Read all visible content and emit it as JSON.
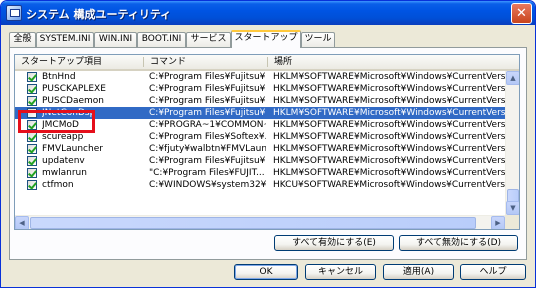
{
  "window": {
    "title": "システム 構成ユーティリティ",
    "close_label": "✕"
  },
  "tabs": [
    {
      "label": "全般"
    },
    {
      "label": "SYSTEM.INI"
    },
    {
      "label": "WIN.INI"
    },
    {
      "label": "BOOT.INI"
    },
    {
      "label": "サービス"
    },
    {
      "label": "スタートアップ"
    },
    {
      "label": "ツール"
    }
  ],
  "active_tab": "スタートアップ",
  "list": {
    "columns": [
      "スタートアップ項目",
      "コマンド",
      "場所"
    ],
    "rows": [
      {
        "name": "BtnHnd",
        "command": "C:¥Program Files¥Fujitsu¥...",
        "location": "HKLM¥SOFTWARE¥Microsoft¥Windows¥CurrentVersion¥Run",
        "checked": true
      },
      {
        "name": "PUSCKAPLEXE",
        "command": "C:¥Program Files¥Fujitsu¥...",
        "location": "HKLM¥SOFTWARE¥Microsoft¥Windows¥CurrentVersion¥Run",
        "checked": true
      },
      {
        "name": "PUSCDaemon",
        "command": "C:¥Program Files¥Fujitsu¥...",
        "location": "HKLM¥SOFTWARE¥Microsoft¥Windows¥CurrentVersion¥Run",
        "checked": true
      },
      {
        "name": "JNetConDsp",
        "command": "C:¥Program Files¥Fujitsu¥...",
        "location": "HKLM¥SOFTWARE¥Microsoft¥Windows¥CurrentVersion¥Run",
        "checked": false,
        "selected": true
      },
      {
        "name": "JMCMoD",
        "command": "C:¥PROGRA~1¥COMMON~...",
        "location": "HKLM¥SOFTWARE¥Microsoft¥Windows¥CurrentVersion¥Run",
        "checked": true
      },
      {
        "name": "scureapp",
        "command": "C:¥Program Files¥Softex¥...",
        "location": "HKLM¥SOFTWARE¥Microsoft¥Windows¥CurrentVersion¥Run",
        "checked": true
      },
      {
        "name": "FMVLauncher",
        "command": "C:¥fjuty¥walbtn¥FMVLaun...",
        "location": "HKLM¥SOFTWARE¥Microsoft¥Windows¥CurrentVersion¥Run",
        "checked": true
      },
      {
        "name": "updatenv",
        "command": "C:¥Program Files¥Fujitsu¥...",
        "location": "HKLM¥SOFTWARE¥Microsoft¥Windows¥CurrentVersion¥Run",
        "checked": true
      },
      {
        "name": "mwlanrun",
        "command": "\"C:¥Program Files¥FUJIT...",
        "location": "HKLM¥SOFTWARE¥Microsoft¥Windows¥CurrentVersion¥Run",
        "checked": true
      },
      {
        "name": "ctfmon",
        "command": "C:¥WINDOWS¥system32¥c...",
        "location": "HKCU¥SOFTWARE¥Microsoft¥Windows¥CurrentVersion¥Run",
        "checked": true
      }
    ]
  },
  "buttons": {
    "enable_all": "すべて有効にする(E)",
    "disable_all": "すべて無効にする(D)",
    "ok": "OK",
    "cancel": "キャンセル",
    "apply": "適用(A)",
    "help": "ヘルプ"
  },
  "scroll": {
    "up": "▲",
    "down": "▼",
    "left": "◀",
    "right": "▶"
  },
  "colors": {
    "selection": "#316ac5",
    "highlight_box": "#e50f1b",
    "titlebar": "#0054e3"
  },
  "icons": {
    "app": "msconfig-icon",
    "close": "close-icon"
  }
}
